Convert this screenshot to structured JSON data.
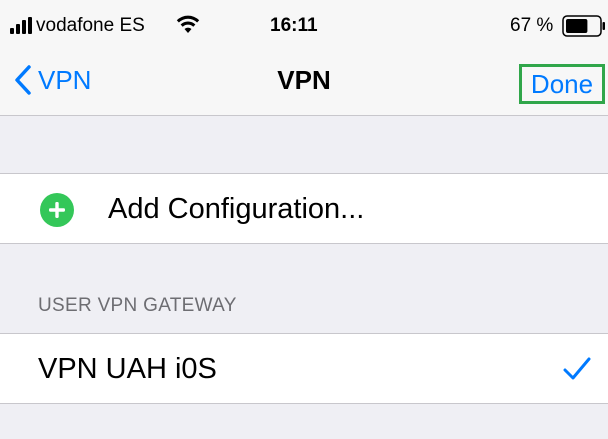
{
  "status_bar": {
    "carrier": "vodafone ES",
    "time": "16:11",
    "battery_percent": "67 %",
    "battery_level": 0.67,
    "icons": [
      "signal-bars-icon",
      "wifi-icon",
      "battery-icon"
    ]
  },
  "nav": {
    "back_label": "VPN",
    "title": "VPN",
    "done_label": "Done"
  },
  "add_configuration": {
    "label": "Add Configuration...",
    "icon": "plus-circle-icon",
    "icon_color": "#34c759"
  },
  "section": {
    "header": "USER VPN GATEWAY",
    "items": [
      {
        "label": "VPN UAH i0S",
        "selected": true
      }
    ]
  },
  "colors": {
    "accent": "#007aff",
    "highlight_border": "#30a64a",
    "background": "#efeff4"
  }
}
